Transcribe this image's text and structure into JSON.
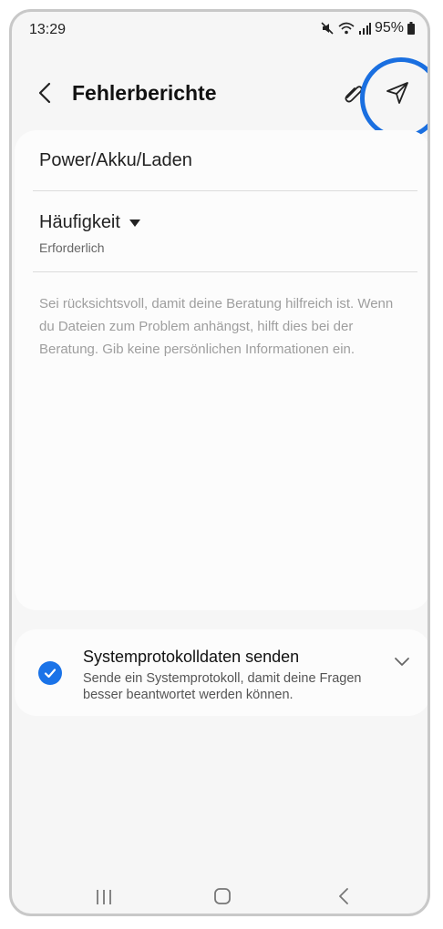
{
  "status_bar": {
    "time": "13:29",
    "battery": "95%"
  },
  "header": {
    "title": "Fehlerberichte"
  },
  "form": {
    "subject": "Power/Akku/Laden",
    "frequency_label": "Häufigkeit",
    "frequency_hint": "Erforderlich",
    "description_placeholder": "Sei rücksichtsvoll, damit deine Beratung hilfreich ist. Wenn du Dateien zum Problem anhängst, hilft dies bei der Beratung. Gib keine persönlichen Informationen ein."
  },
  "system_log": {
    "title": "Systemprotokolldaten senden",
    "description": "Sende ein Systemprotokoll, damit deine Fragen besser beantwortet werden können.",
    "checked": true
  },
  "colors": {
    "accent": "#1a73e8",
    "highlight_ring": "#1a6fe0"
  },
  "icons": [
    "back-icon",
    "attach-icon",
    "send-icon",
    "check-icon",
    "chevron-down-icon",
    "recent-apps-icon",
    "home-icon",
    "back-nav-icon",
    "mute-icon",
    "wifi-icon",
    "signal-icon",
    "battery-icon"
  ]
}
